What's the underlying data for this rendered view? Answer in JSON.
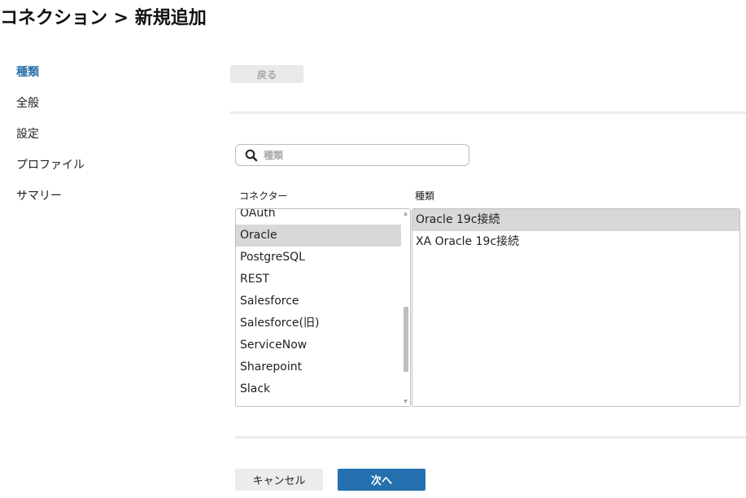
{
  "header": {
    "title": "コネクション > 新規追加"
  },
  "steps": [
    {
      "label": "種類",
      "active": true
    },
    {
      "label": "全般"
    },
    {
      "label": "設定"
    },
    {
      "label": "プロファイル"
    },
    {
      "label": "サマリー"
    }
  ],
  "toolbar": {
    "back_label": "戻る"
  },
  "search": {
    "placeholder": "種類",
    "value": ""
  },
  "columns": {
    "connector_header": "コネクター",
    "type_header": "種類"
  },
  "connectors": {
    "items": [
      "OAuth",
      "Oracle",
      "PostgreSQL",
      "REST",
      "Salesforce",
      "Salesforce(旧)",
      "ServiceNow",
      "Sharepoint",
      "Slack"
    ],
    "selected": "Oracle"
  },
  "types": {
    "items": [
      "Oracle 19c接続",
      "XA Oracle 19c接続"
    ],
    "selected": "Oracle 19c接続"
  },
  "footer": {
    "cancel_label": "キャンセル",
    "next_label": "次へ"
  },
  "colors": {
    "accent": "#2470ae",
    "active_step": "#2a6fa8",
    "selected_row": "#d8d8d8"
  }
}
